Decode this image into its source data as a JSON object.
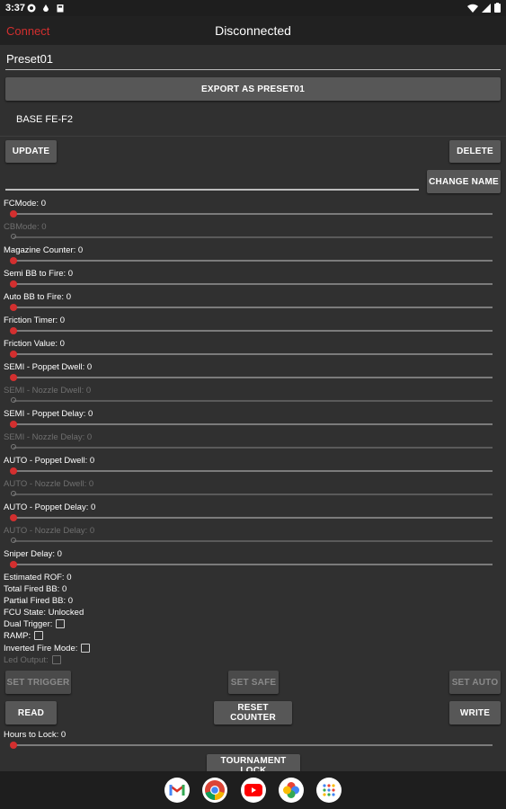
{
  "status_bar": {
    "time": "3:37"
  },
  "app_bar": {
    "connect_label": "Connect",
    "title": "Disconnected"
  },
  "preset": {
    "name_value": "Preset01",
    "export_label": "EXPORT AS PRESET01",
    "list_item": "BASE FE-F2"
  },
  "buttons": {
    "update": "UPDATE",
    "delete": "DELETE",
    "change_name": "CHANGE NAME",
    "set_trigger": "SET TRIGGER",
    "set_safe": "SET SAFE",
    "set_auto": "SET AUTO",
    "read": "READ",
    "reset_counter": "RESET COUNTER",
    "write": "WRITE",
    "tournament_lock": "TOURNAMENT LOCK"
  },
  "sliders": [
    {
      "label": "FCMode: 0",
      "enabled": true,
      "value": 0
    },
    {
      "label": "CBMode: 0",
      "enabled": false,
      "value": 0
    },
    {
      "label": "Magazine Counter: 0",
      "enabled": true,
      "value": 0
    },
    {
      "label": "Semi BB to Fire: 0",
      "enabled": true,
      "value": 0
    },
    {
      "label": "Auto BB to Fire: 0",
      "enabled": true,
      "value": 0
    },
    {
      "label": "Friction Timer: 0",
      "enabled": true,
      "value": 0
    },
    {
      "label": "Friction Value: 0",
      "enabled": true,
      "value": 0
    },
    {
      "label": "SEMI - Poppet Dwell: 0",
      "enabled": true,
      "value": 0
    },
    {
      "label": "SEMI - Nozzle Dwell: 0",
      "enabled": false,
      "value": 0
    },
    {
      "label": "SEMI - Poppet Delay: 0",
      "enabled": true,
      "value": 0
    },
    {
      "label": "SEMI - Nozzle Delay: 0",
      "enabled": false,
      "value": 0
    },
    {
      "label": "AUTO - Poppet Dwell: 0",
      "enabled": true,
      "value": 0
    },
    {
      "label": "AUTO - Nozzle Dwell: 0",
      "enabled": false,
      "value": 0
    },
    {
      "label": "AUTO - Poppet Delay: 0",
      "enabled": true,
      "value": 0
    },
    {
      "label": "AUTO - Nozzle Delay: 0",
      "enabled": false,
      "value": 0
    },
    {
      "label": "Sniper Delay: 0",
      "enabled": true,
      "value": 0
    }
  ],
  "info": {
    "estimated_rof": "Estimated ROF: 0",
    "total_fired": "Total Fired BB: 0",
    "partial_fired": "Partial Fired BB: 0",
    "fcu_state": "FCU State: Unlocked"
  },
  "checkboxes": {
    "dual_trigger": "Dual Trigger:",
    "ramp": "RAMP:",
    "inverted_fire_mode": "Inverted Fire Mode:",
    "led_output": "Led Output:"
  },
  "hours_to_lock": {
    "label": "Hours to Lock: 0",
    "value": 0
  },
  "nav_apps": [
    "gmail-icon",
    "chrome-icon",
    "youtube-icon",
    "photos-icon",
    "app-drawer-icon"
  ]
}
